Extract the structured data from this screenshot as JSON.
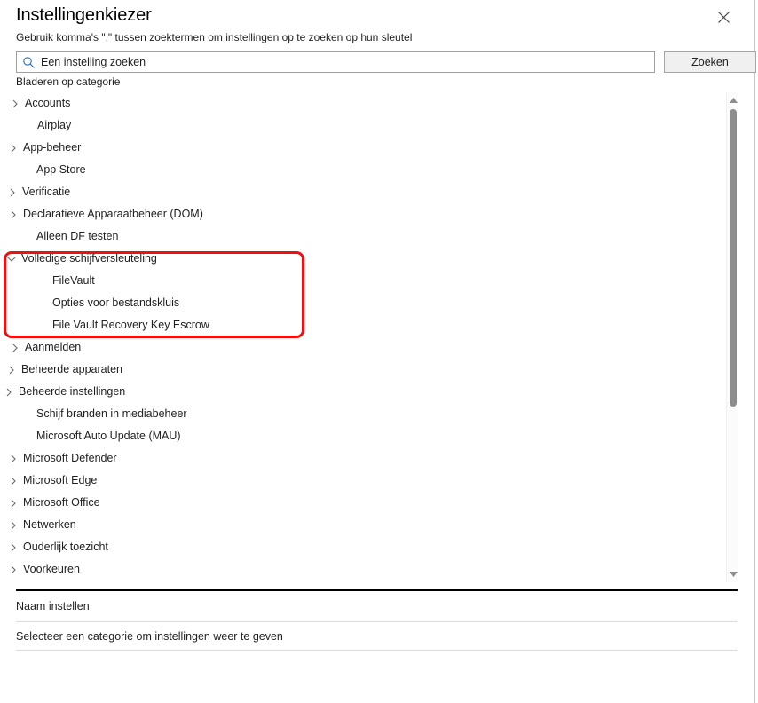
{
  "window": {
    "title": "Instellingenkiezer",
    "subtitle": "Gebruik komma's \",\" tussen zoektermen om instellingen op te zoeken op hun sleutel",
    "close_icon": "close-icon"
  },
  "search": {
    "icon": "search-icon",
    "value": "",
    "placeholder": "Een instelling zoeken",
    "button_label": "Zoeken"
  },
  "browse": {
    "label": "Bladeren op categorie"
  },
  "tree": {
    "items": [
      {
        "label": "Accounts",
        "state": "collapsed",
        "indent": 24,
        "level": 0
      },
      {
        "label": "Airplay",
        "state": "leaf",
        "indent": 38,
        "level": 0
      },
      {
        "label": "App-beheer",
        "state": "collapsed",
        "indent": 22,
        "level": 0
      },
      {
        "label": "App Store",
        "state": "leaf",
        "indent": 37,
        "level": 0
      },
      {
        "label": "Verificatie",
        "state": "collapsed",
        "indent": 21,
        "level": 0
      },
      {
        "label": "Declaratieve Apparaatbeheer (DOM)",
        "state": "collapsed",
        "indent": 22,
        "level": 0
      },
      {
        "label": "Alleen DF testen",
        "state": "leaf",
        "indent": 37,
        "level": 0
      },
      {
        "label": "Volledige schijfversleuteling",
        "state": "expanded",
        "indent": 20,
        "level": 0
      },
      {
        "label": "FileVault",
        "state": "leaf",
        "indent": 55,
        "level": 1
      },
      {
        "label": "Opties voor bestandskluis",
        "state": "leaf",
        "indent": 55,
        "level": 1
      },
      {
        "label": "File Vault Recovery Key Escrow",
        "state": "leaf",
        "indent": 55,
        "level": 1
      },
      {
        "label": "Aanmelden",
        "state": "collapsed",
        "indent": 24,
        "level": 0
      },
      {
        "label": "Beheerde apparaten",
        "state": "collapsed",
        "indent": 20,
        "level": 0
      },
      {
        "label": "Beheerde instellingen",
        "state": "collapsed",
        "indent": 17,
        "level": 0
      },
      {
        "label": "Schijf branden in mediabeheer",
        "state": "leaf",
        "indent": 37,
        "level": 0
      },
      {
        "label": "Microsoft Auto Update (MAU)",
        "state": "leaf",
        "indent": 37,
        "level": 0
      },
      {
        "label": "Microsoft Defender",
        "state": "collapsed",
        "indent": 22,
        "level": 0
      },
      {
        "label": "Microsoft Edge",
        "state": "collapsed",
        "indent": 22,
        "level": 0
      },
      {
        "label": "Microsoft Office",
        "state": "collapsed",
        "indent": 22,
        "level": 0
      },
      {
        "label": "Netwerken",
        "state": "collapsed",
        "indent": 22,
        "level": 0
      },
      {
        "label": "Ouderlijk toezicht",
        "state": "collapsed",
        "indent": 22,
        "level": 0
      },
      {
        "label": "Voorkeuren",
        "state": "collapsed",
        "indent": 22,
        "level": 0
      }
    ]
  },
  "highlight": {
    "name": "red-annotation-box",
    "color": "#ee1111",
    "covers": [
      "Volledige schijfversleuteling",
      "FileVault",
      "Opties voor bestandskluis",
      "File Vault Recovery Key Escrow"
    ]
  },
  "scrollbar": {
    "up_icon": "scroll-up-arrow-icon",
    "down_icon": "scroll-down-arrow-icon"
  },
  "footer": {
    "name_setting_label": "Naam instellen",
    "status_text": "Selecteer een categorie om instellingen weer te geven"
  }
}
